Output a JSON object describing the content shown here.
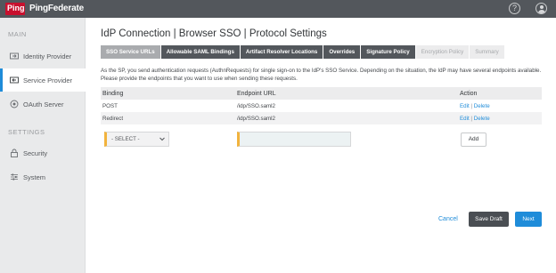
{
  "header": {
    "logo_mark": "Ping",
    "app_name": "PingFederate",
    "help_icon": "question-circle-icon",
    "user_icon": "user-avatar-icon"
  },
  "sidebar": {
    "sections": [
      {
        "title": "MAIN",
        "items": [
          {
            "label": "Identity Provider",
            "icon": "identity-provider-icon",
            "active": false
          },
          {
            "label": "Service Provider",
            "icon": "service-provider-icon",
            "active": true
          },
          {
            "label": "OAuth Server",
            "icon": "oauth-server-icon",
            "active": false
          }
        ]
      },
      {
        "title": "SETTINGS",
        "items": [
          {
            "label": "Security",
            "icon": "lock-icon",
            "active": false
          },
          {
            "label": "System",
            "icon": "sliders-icon",
            "active": false
          }
        ]
      }
    ]
  },
  "main": {
    "title": "IdP Connection | Browser SSO | Protocol Settings",
    "tabs": [
      {
        "label": "SSO Service URLs",
        "state": "active"
      },
      {
        "label": "Allowable SAML Bindings",
        "state": "enabled"
      },
      {
        "label": "Artifact Resolver Locations",
        "state": "enabled"
      },
      {
        "label": "Overrides",
        "state": "enabled"
      },
      {
        "label": "Signature Policy",
        "state": "enabled"
      },
      {
        "label": "Encryption Policy",
        "state": "disabled"
      },
      {
        "label": "Summary",
        "state": "disabled"
      }
    ],
    "description": "As the SP, you send authentication requests (AuthnRequests) for single sign-on to the IdP's SSO Service. Depending on the situation, the IdP may have several endpoints available. Please provide the endpoints that you want to use when sending these requests.",
    "table": {
      "columns": [
        "Binding",
        "Endpoint URL",
        "Action"
      ],
      "rows": [
        {
          "binding": "POST",
          "endpoint": "/idp/SSO.saml2",
          "edit": "Edit",
          "separator": "|",
          "delete": "Delete"
        },
        {
          "binding": "Redirect",
          "endpoint": "/idp/SSO.saml2",
          "edit": "Edit",
          "separator": "|",
          "delete": "Delete"
        }
      ]
    },
    "new_row": {
      "binding_select_value": "- SELECT -",
      "endpoint_value": "",
      "add_label": "Add"
    },
    "footer": {
      "cancel_label": "Cancel",
      "save_draft_label": "Save Draft",
      "next_label": "Next"
    }
  },
  "colors": {
    "topbar": "#53575c",
    "brand_red": "#c8102e",
    "accent_blue": "#1f8cd9",
    "required_marker": "#f2b33d"
  }
}
